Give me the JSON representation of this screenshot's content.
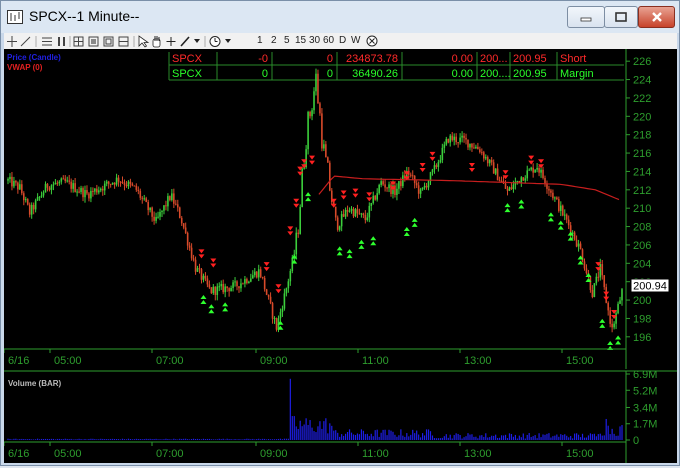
{
  "window": {
    "title": "SPCX--1 Minute--"
  },
  "toolbar": {
    "intervals": [
      "1",
      "2",
      "5",
      "15",
      "30",
      "60",
      "D",
      "W"
    ]
  },
  "legend": {
    "price_label": "Price (Candle)",
    "vwap_label": "VWAP (0)",
    "volume_label": "Volume (BAR)"
  },
  "quote_table": {
    "rows": [
      {
        "symbol": "SPCX",
        "c1": "-0",
        "c2": "0",
        "c3": "234873.78",
        "c4": "0.00",
        "c5": "200...",
        "c6": "200.95",
        "side": "Short",
        "color": "#ff2a2a"
      },
      {
        "symbol": "SPCX",
        "c1": "0",
        "c2": "0",
        "c3": "36490.26",
        "c4": "0.00",
        "c5": "200....",
        "c6": "200.95",
        "side": "Margin",
        "color": "#2aff2a"
      }
    ]
  },
  "colors": {
    "up": "#3ccf3c",
    "down": "#d84a2a",
    "vwap": "#c81e1e",
    "buy_signal": "#2eff2e",
    "sell_signal": "#ff2020",
    "volume": "#1e1ee6",
    "axis": "#2e9e2e"
  },
  "chart_data": [
    {
      "type": "candlestick",
      "ylim": [
        195,
        227
      ],
      "y_ticks": [
        "226",
        "224",
        "222",
        "220",
        "218",
        "216",
        "214",
        "212",
        "210",
        "208",
        "206",
        "204",
        "202",
        "200",
        "198",
        "196"
      ],
      "x_ticks": [
        "6/16",
        "05:00",
        "07:00",
        "09:00",
        "11:00",
        "13:00",
        "15:00"
      ],
      "last_price": "200.94",
      "close_anchors": [
        [
          0,
          213
        ],
        [
          12,
          212.2
        ],
        [
          22,
          209.5
        ],
        [
          40,
          212.5
        ],
        [
          58,
          212.8
        ],
        [
          80,
          211.5
        ],
        [
          112,
          213.2
        ],
        [
          130,
          212
        ],
        [
          150,
          208.5
        ],
        [
          165,
          211.4
        ],
        [
          175,
          209
        ],
        [
          190,
          203.5
        ],
        [
          205,
          201
        ],
        [
          230,
          201.5
        ],
        [
          255,
          203.2
        ],
        [
          272,
          197
        ],
        [
          282,
          201.3
        ],
        [
          292,
          206
        ],
        [
          302,
          218
        ],
        [
          312,
          224
        ],
        [
          320,
          216
        ],
        [
          333,
          208
        ],
        [
          345,
          210
        ],
        [
          362,
          208.8
        ],
        [
          378,
          212.8
        ],
        [
          392,
          211.8
        ],
        [
          405,
          214
        ],
        [
          418,
          211.6
        ],
        [
          432,
          214.2
        ],
        [
          446,
          217.6
        ],
        [
          462,
          217.4
        ],
        [
          478,
          216.4
        ],
        [
          492,
          214.2
        ],
        [
          506,
          211.8
        ],
        [
          520,
          213.4
        ],
        [
          536,
          214.6
        ],
        [
          552,
          211.4
        ],
        [
          568,
          208.2
        ],
        [
          580,
          205.4
        ],
        [
          592,
          200.8
        ],
        [
          600,
          203.4
        ],
        [
          608,
          198.8
        ],
        [
          612,
          196.8
        ],
        [
          622,
          200.9
        ]
      ],
      "vwap_anchors": [
        [
          315,
          211.5
        ],
        [
          330,
          213.5
        ],
        [
          360,
          213.2
        ],
        [
          450,
          213
        ],
        [
          560,
          212.6
        ],
        [
          595,
          212
        ],
        [
          622,
          210.8
        ]
      ],
      "volume_ylim": [
        0,
        6900000
      ],
      "volume_ticks": [
        "6.9M",
        "5.2M",
        "3.4M",
        "1.7M",
        "0"
      ]
    }
  ]
}
